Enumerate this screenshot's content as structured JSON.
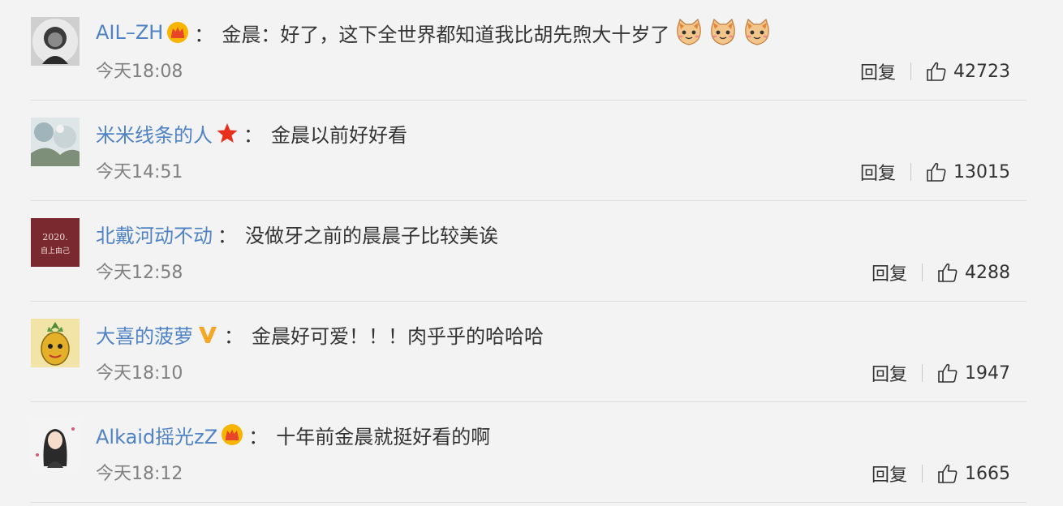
{
  "comments": [
    {
      "username": "AIL–ZH",
      "badge": "crown-badge-icon",
      "text": "金晨：好了，这下全世界都知道我比胡先煦大十岁了",
      "emojis": [
        "cat-face-icon",
        "cat-face-icon",
        "cat-face-icon"
      ],
      "time": "今天18:08",
      "reply": "回复",
      "likes": "42723"
    },
    {
      "username": "米米线条的人",
      "badge": "red-star-icon",
      "text": "金晨以前好好看",
      "emojis": [],
      "time": "今天14:51",
      "reply": "回复",
      "likes": "13015"
    },
    {
      "username": "北戴河动不动",
      "badge": "",
      "text": "没做牙之前的晨晨子比较美诶",
      "emojis": [],
      "time": "今天12:58",
      "reply": "回复",
      "likes": "4288"
    },
    {
      "username": "大喜的菠萝",
      "badge": "gold-v-icon",
      "text": "金晨好可爱！！！肉乎乎的哈哈哈",
      "emojis": [],
      "time": "今天18:10",
      "reply": "回复",
      "likes": "1947"
    },
    {
      "username": "Alkaid摇光zZ",
      "badge": "crown-badge-icon",
      "text": "十年前金晨就挺好看的啊",
      "emojis": [],
      "time": "今天18:12",
      "reply": "回复",
      "likes": "1665"
    }
  ],
  "avatar_text": {
    "c3_top": "2020.",
    "c3_bottom": "自上由己"
  },
  "colors": {
    "username": "#4f83c5",
    "text": "#333333",
    "time": "#808080",
    "background": "#f3f3f3",
    "divider": "#dcdcdc"
  }
}
